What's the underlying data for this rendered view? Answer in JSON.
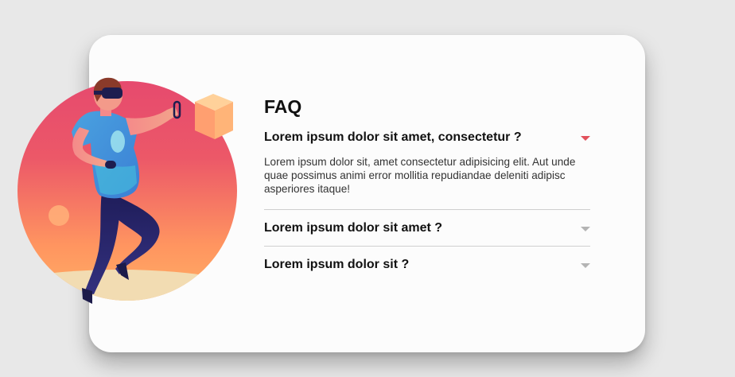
{
  "faq": {
    "title": "FAQ",
    "items": [
      {
        "question": "Lorem ipsum dolor sit amet, consectetur ?",
        "answer": "Lorem ipsum dolor sit, amet consectetur adipisicing elit. Aut unde quae possimus animi error mollitia repudiandae deleniti adipisc asperiores itaque!",
        "expanded": true
      },
      {
        "question": "Lorem ipsum dolor sit amet ?",
        "expanded": false
      },
      {
        "question": "Lorem ipsum dolor sit ?",
        "expanded": false
      }
    ]
  },
  "colors": {
    "accent_open_caret": "#e2515c",
    "closed_caret": "#b4b4b4",
    "circle_top": "#e64a6e",
    "circle_bottom": "#ff9c5e",
    "ground": "#f2dcb2"
  },
  "icons": {
    "illustration": "vr-player-illustration",
    "caret_open": "caret-down-icon",
    "caret_closed": "caret-down-icon"
  }
}
